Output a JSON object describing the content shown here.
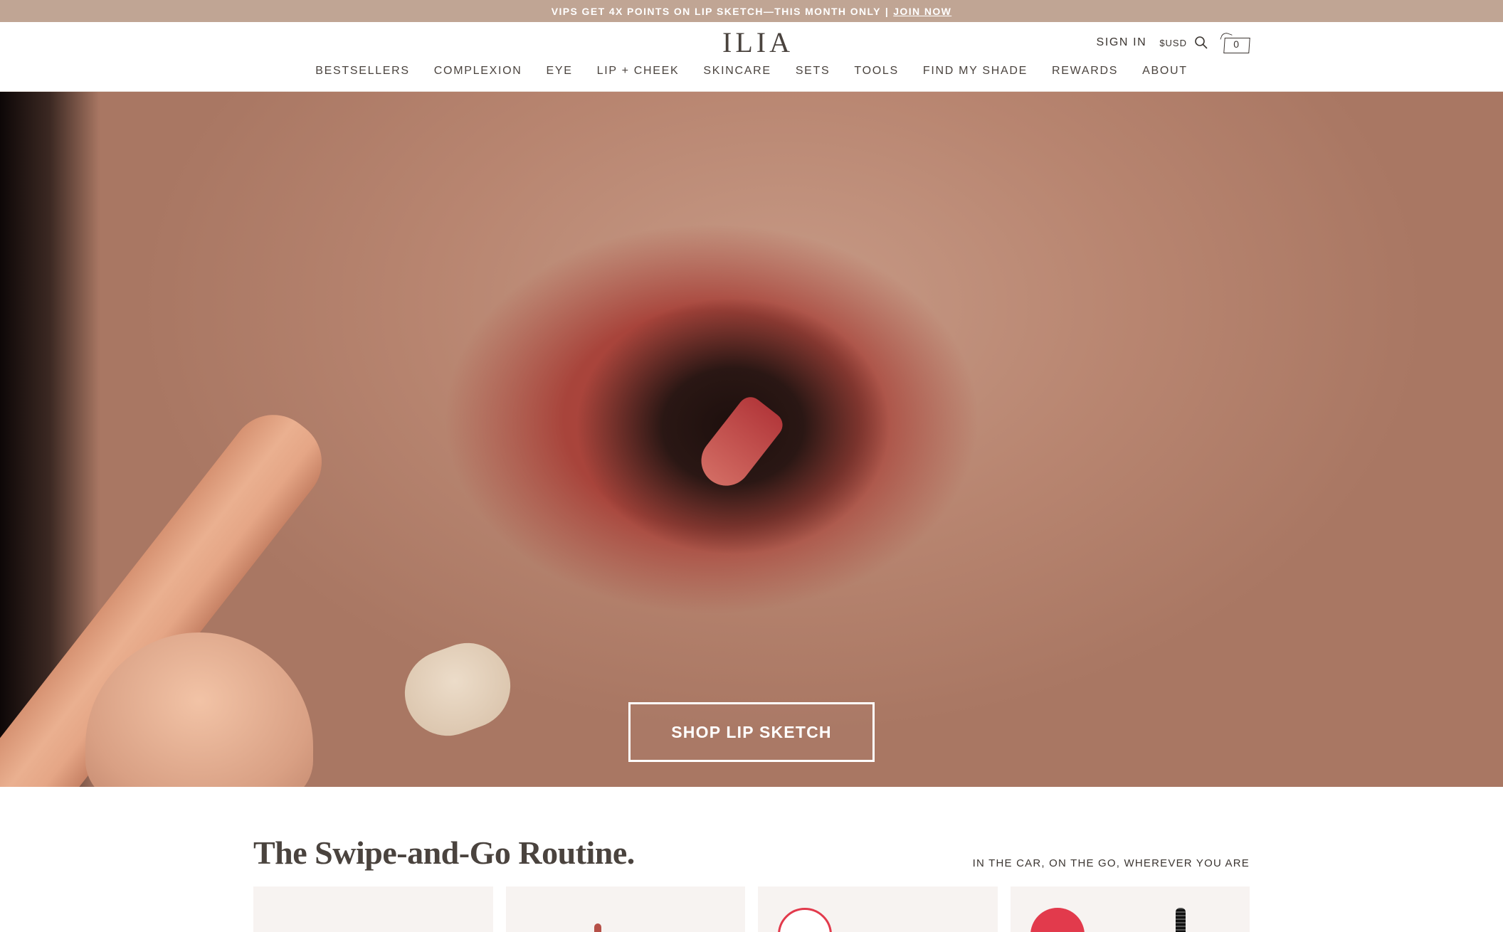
{
  "announcement": {
    "text": "VIPS GET 4X POINTS ON LIP SKETCH—THIS MONTH ONLY",
    "separator": "|",
    "link": "JOIN NOW"
  },
  "header": {
    "logo": "ILIA",
    "sign_in": "SIGN IN",
    "currency": "$USD",
    "cart_count": "0"
  },
  "nav": {
    "items": [
      "BESTSELLERS",
      "COMPLEXION",
      "EYE",
      "LIP + CHEEK",
      "SKINCARE",
      "SETS",
      "TOOLS",
      "FIND MY SHADE",
      "REWARDS",
      "ABOUT"
    ]
  },
  "hero": {
    "cta": "SHOP LIP SKETCH"
  },
  "section": {
    "title": "The Swipe-and-Go Routine.",
    "subtitle": "IN THE CAR, ON THE GO, WHEREVER YOU ARE"
  },
  "colors": {
    "announcement_bg": "#c0a594",
    "text": "#3b3531",
    "badge_red": "#e23a4c"
  }
}
